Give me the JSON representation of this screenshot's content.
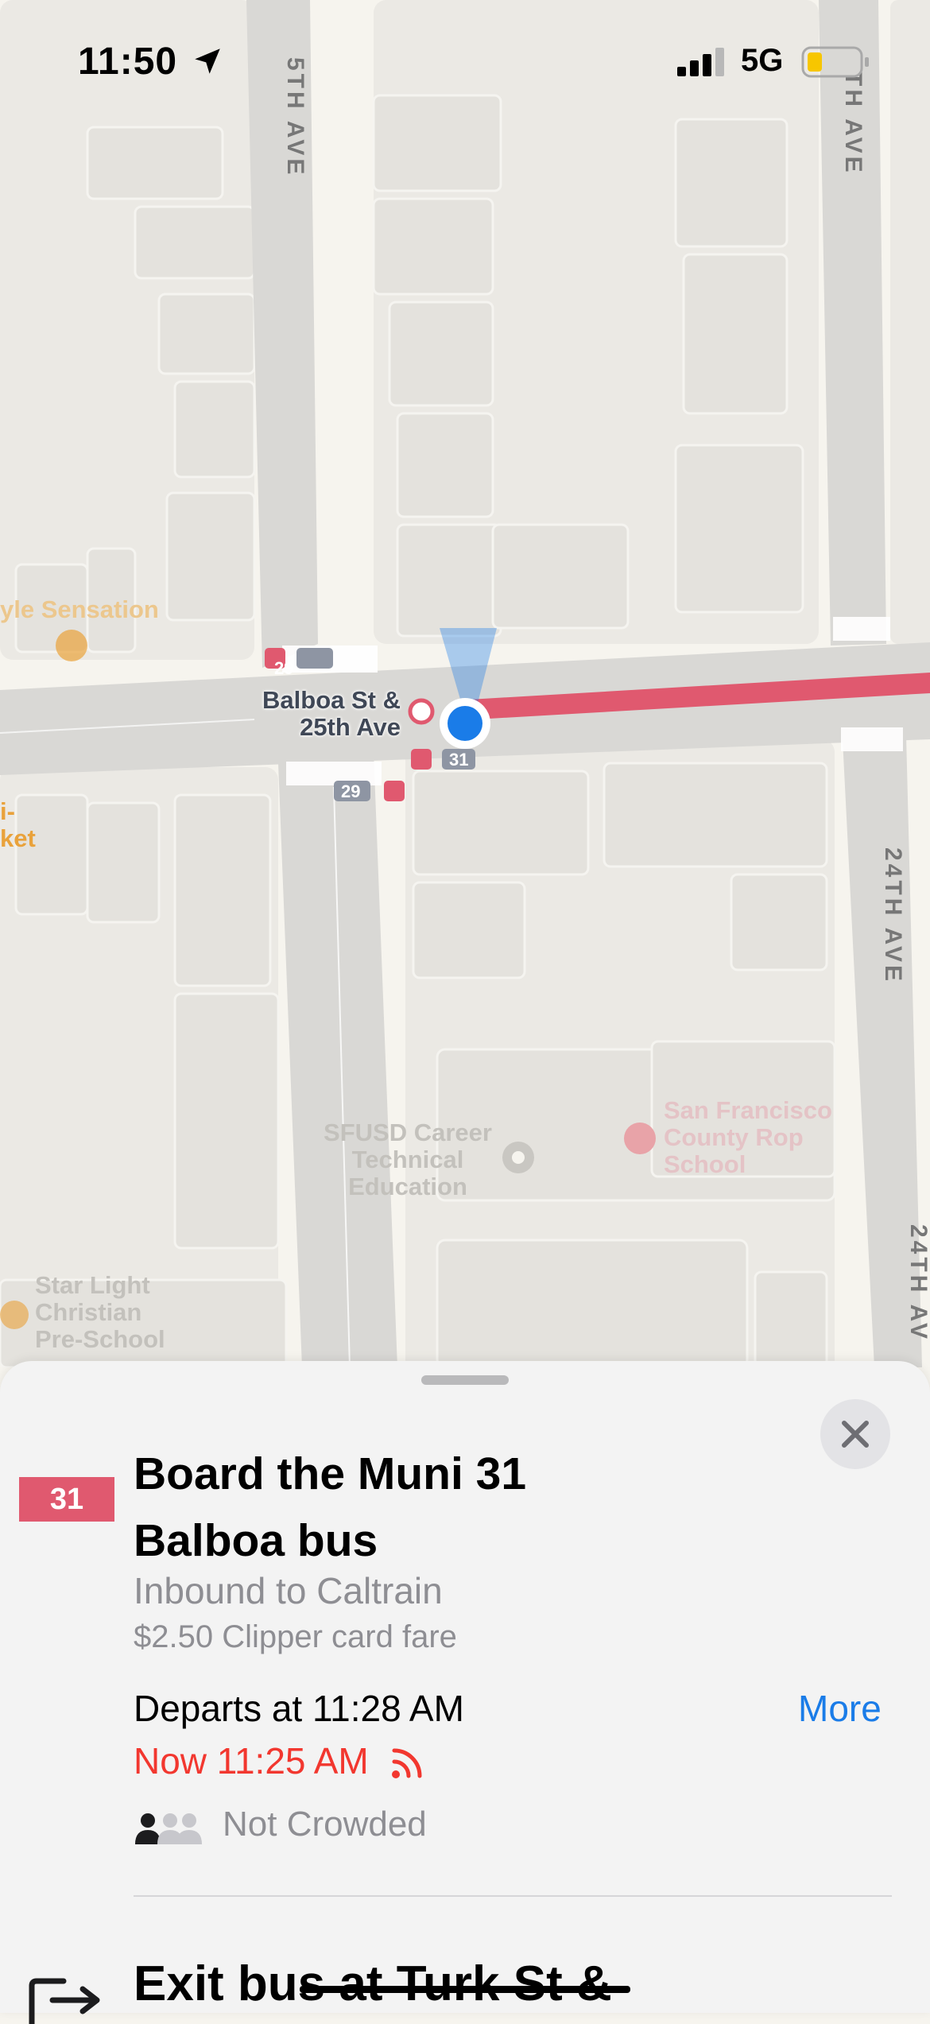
{
  "status_bar": {
    "time": "11:50",
    "network": "5G",
    "icons": [
      "location-arrow-icon",
      "cellular-signal-icon",
      "battery-low-icon"
    ]
  },
  "map": {
    "streets": {
      "top_left_avenue": "5TH AVE",
      "top_right_avenue": "TH AVE",
      "right_avenue": "24TH AVE",
      "bottom_right_avenue": "24TH AV"
    },
    "stop": {
      "name_line1": "Balboa St &",
      "name_line2": "25th Ave",
      "route_badge_top": "29",
      "route_badge_bottom_left": "29",
      "route_badge_bottom_right": "31"
    },
    "pois": {
      "left_business": "yle Sensation",
      "left_market_line1": "i-",
      "left_market_line2": "ket",
      "career_ed_line1": "SFUSD Career",
      "career_ed_line2": "Technical",
      "career_ed_line3": "Education",
      "rop_school_line1": "San Francisco",
      "rop_school_line2": "County Rop",
      "rop_school_line3": "School",
      "preschool_line1": "Star Light",
      "preschool_line2": "Christian",
      "preschool_line3": "Pre-School"
    },
    "colors": {
      "route_line": "#e0596f",
      "user_location": "#1a7ce8",
      "poi_orange": "#e9a23b"
    }
  },
  "step": {
    "route_number": "31",
    "title_line1": "Board the Muni 31",
    "title_line2": "Balboa bus",
    "direction": "Inbound to Caltrain",
    "fare": "$2.50 Clipper card fare",
    "departs": "Departs at 11:28 AM",
    "more_label": "More",
    "realtime": "Now 11:25 AM",
    "crowding": "Not Crowded",
    "next_step_text": "Exit bus at Turk St &"
  }
}
